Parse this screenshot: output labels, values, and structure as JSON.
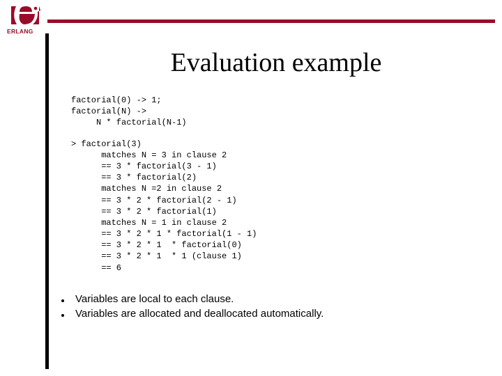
{
  "logo": {
    "text": "ERLANG"
  },
  "title": "Evaluation example",
  "code": {
    "block1": "factorial(0) -> 1;\nfactorial(N) ->\n     N * factorial(N-1)",
    "block2": "> factorial(3)\n      matches N = 3 in clause 2\n      == 3 * factorial(3 - 1)\n      == 3 * factorial(2)\n      matches N =2 in clause 2\n      == 3 * 2 * factorial(2 - 1)\n      == 3 * 2 * factorial(1)\n      matches N = 1 in clause 2\n      == 3 * 2 * 1 * factorial(1 - 1)\n      == 3 * 2 * 1  * factorial(0)\n      == 3 * 2 * 1  * 1 (clause 1)\n      == 6"
  },
  "bullets": [
    "Variables are local to each clause.",
    "Variables are allocated and deallocated automatically."
  ]
}
